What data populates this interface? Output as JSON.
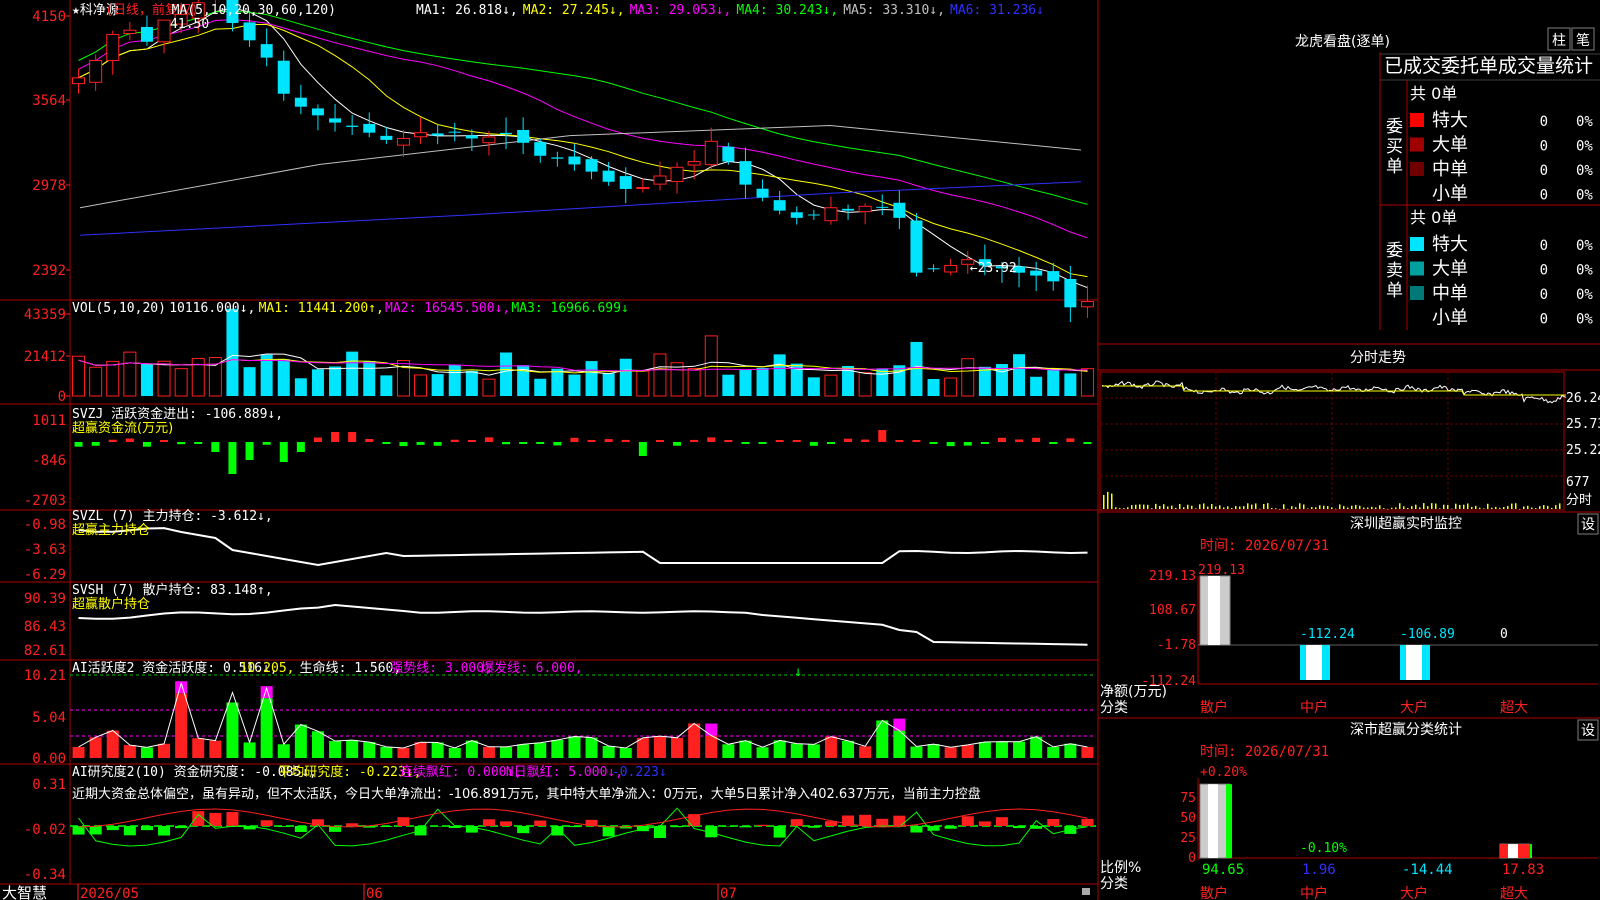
{
  "app": {
    "brand": "大智慧",
    "date_labels": [
      "2026/05",
      "06",
      "07"
    ]
  },
  "kline": {
    "title": "★科净源",
    "mode": "(日线，前复权)",
    "ma": "MA(5,10,20,30,60,120)",
    "ma_values": [
      {
        "label": "MA1: 26.818↓,",
        "color": "#ffffff"
      },
      {
        "label": "MA2: 27.245↓,",
        "color": "#ffff00"
      },
      {
        "label": "MA3: 29.053↓,",
        "color": "#ff00ff"
      },
      {
        "label": "MA4: 30.243↓,",
        "color": "#00ff00"
      },
      {
        "label": "MA5: 33.310↓,",
        "color": "#c0c0c0"
      },
      {
        "label": "MA6: 31.236↓",
        "color": "#3030ff"
      }
    ],
    "axis": [
      "4150",
      "3564",
      "2978",
      "2392"
    ],
    "high_mark": "41.50",
    "low_mark": "←23.92"
  },
  "vol": {
    "title": "VOL(5,10,20)",
    "values": [
      {
        "label": "10116.000↓,",
        "color": "#ffffff"
      },
      {
        "label": "MA1: 11441.200↑,",
        "color": "#ffff00"
      },
      {
        "label": "MA2: 16545.500↓,",
        "color": "#ff00ff"
      },
      {
        "label": "MA3: 16966.699↓",
        "color": "#00ff00"
      }
    ],
    "axis": [
      "43359",
      "21412",
      "0"
    ]
  },
  "svzj": {
    "title": "SVZJ  活跃资金进出: -106.889↓,",
    "sub": "超赢资金流(万元)",
    "axis": [
      "1011",
      "-846",
      "-2703"
    ]
  },
  "svzl": {
    "title": "SVZL (7) 主力持仓: -3.612↓,",
    "sub": "超赢主力持仓",
    "axis": [
      "-0.98",
      "-3.63",
      "-6.29"
    ]
  },
  "svsh": {
    "title": "SVSH (7) 散户持仓: 83.148↑,",
    "sub": "超赢散户持仓",
    "axis": [
      "90.39",
      "86.43",
      "82.61"
    ]
  },
  "ai1": {
    "segments": [
      {
        "label": "AI活跃度2 资金活跃度: 0.516↓,",
        "color": "#ffffff"
      },
      {
        "label": "10.205,",
        "color": "#ffff00"
      },
      {
        "label": "生命线: 1.560,",
        "color": "#ffffff"
      },
      {
        "label": "强势线: 3.000,",
        "color": "#ff00ff"
      },
      {
        "label": "爆发线: 6.000,",
        "color": "#ff00ff"
      }
    ],
    "axis": [
      "10.21",
      "5.04",
      "0.00"
    ]
  },
  "ai2": {
    "segments": [
      {
        "label": "AI研究度2(10) 资金研究度: -0.085↓,",
        "color": "#ffffff"
      },
      {
        "label": "平均研究度: -0.223↓,",
        "color": "#ffff00"
      },
      {
        "label": "连续飘红: 0.000↓,",
        "color": "#ff00ff"
      },
      {
        "label": "N日飘红: 5.000↓,",
        "color": "#ff00ff"
      },
      {
        "label": "-0.223↓",
        "color": "#3030ff"
      }
    ],
    "comment": "近期大资金总体偏空，虽有异动，但不太活跃，今日大单净流出：-106.891万元，其中特大单净流入：0万元，大单5日累计净入402.637万元，当前主力控盘",
    "axis": [
      "0.31",
      "-0.02",
      "-0.34"
    ]
  },
  "lhb": {
    "title": "龙虎看盘(逐单)",
    "tabs": [
      "柱",
      "笔"
    ],
    "headline": "已成交委托单成交量统计",
    "buy_side": "委买单",
    "sell_side": "委卖单",
    "buy_total": "共 0单",
    "sell_total": "共 0单",
    "buy_rows": [
      {
        "name": "特大",
        "count": "0",
        "pct": "0%",
        "color": "#ff0000"
      },
      {
        "name": "大单",
        "count": "0",
        "pct": "0%",
        "color": "#a00000"
      },
      {
        "name": "中单",
        "count": "0",
        "pct": "0%",
        "color": "#700000"
      },
      {
        "name": "小单",
        "count": "0",
        "pct": "0%",
        "color": "#000000"
      }
    ],
    "sell_rows": [
      {
        "name": "特大",
        "count": "0",
        "pct": "0%",
        "color": "#00e5ff"
      },
      {
        "name": "大单",
        "count": "0",
        "pct": "0%",
        "color": "#00a0a0"
      },
      {
        "name": "中单",
        "count": "0",
        "pct": "0%",
        "color": "#007878"
      },
      {
        "name": "小单",
        "count": "0",
        "pct": "0%",
        "color": "#000000"
      }
    ]
  },
  "fenshi": {
    "title": "分时走势",
    "axis": [
      "26.24",
      "25.73",
      "25.22",
      "677"
    ],
    "label": "分时"
  },
  "sz_monitor": {
    "title": "深圳超赢实时监控",
    "setting": "设",
    "time": "时间: 2026/07/31",
    "axis": [
      "219.13",
      "108.67",
      "-1.78",
      "-112.24"
    ],
    "unit": "净额(万元)",
    "cat_label": "分类",
    "cats": [
      "散户",
      "中户",
      "大户",
      "超大"
    ],
    "values": [
      219.13,
      -112.24,
      -106.89,
      0
    ],
    "value_labels": [
      "219.13",
      "-112.24",
      "-106.89",
      "0"
    ]
  },
  "sz_class": {
    "title": "深市超赢分类统计",
    "setting": "设",
    "time": "时间: 2026/07/31",
    "axis": [
      "75",
      "50",
      "25",
      "0"
    ],
    "unit": "比例%",
    "cat_label": "分类",
    "cats": [
      "散户",
      "中户",
      "大户",
      "超大"
    ],
    "values": [
      94.65,
      1.96,
      -14.44,
      17.83
    ],
    "value_labels": [
      "94.65",
      "1.96",
      "-14.44",
      "17.83"
    ],
    "top_labels": [
      "+0.20%",
      "-0.10%"
    ]
  }
}
